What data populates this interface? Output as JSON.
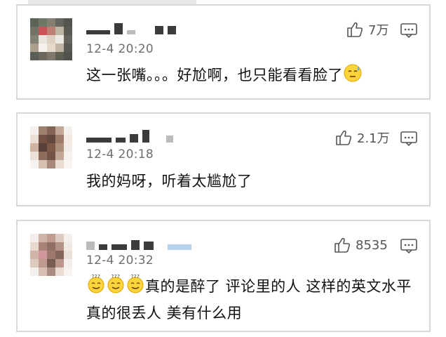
{
  "comments": [
    {
      "timestamp": "12-4 20:20",
      "text": "这一张嘴。。。好尬啊，也只能看看脸了",
      "likes": "7万",
      "avatar_colors": [
        "#3d4a3a",
        "#56604e",
        "#6f6a5a",
        "#4a4c42",
        "#34382f",
        "#5a5c4e",
        "#c3363a",
        "#b46a5e",
        "#b1aa93",
        "#3d3f36",
        "#6e6c5a",
        "#e6e0d6",
        "#d8cab8",
        "#e8e4dc",
        "#4a4a40",
        "#9b8f78",
        "#f4efe9",
        "#e3d4c1",
        "#b6a892",
        "#3a3c34",
        "#3d443a",
        "#544e43",
        "#6b6153",
        "#424236",
        "#33352f"
      ]
    },
    {
      "timestamp": "12-4 20:18",
      "text": "我的妈呀，听着太尴尬了",
      "likes": "2.1万",
      "avatar_colors": [
        "#f2eeea",
        "#8d6b54",
        "#6f4a38",
        "#b79a86",
        "#f3efeb",
        "#e6dad0",
        "#5a3323",
        "#4a2a1e",
        "#8c6652",
        "#efe6de",
        "#c8a690",
        "#3a2016",
        "#6b3d2b",
        "#9e7c66",
        "#f0e8e2",
        "#e8dcd2",
        "#7a5440",
        "#5b3626",
        "#b99a86",
        "#f4f0ec",
        "#f5f2ef",
        "#d0b6a2",
        "#9a7462",
        "#e6d8cc",
        "#f6f3f0"
      ]
    },
    {
      "timestamp": "12-4 20:32",
      "text": "真的是醉了 评论里的人 这样的英文水平真的很丢人  美有什么用",
      "likes": "8535",
      "avatar_colors": [
        "#f1ece8",
        "#c7a899",
        "#b68d7d",
        "#d8c3b7",
        "#f3eeea",
        "#e4d3c9",
        "#9b6f5f",
        "#7d564a",
        "#a57f70",
        "#efe6e0",
        "#c9a79a",
        "#c9868d",
        "#8e6154",
        "#6f4b41",
        "#e8dcd4",
        "#d9c3b6",
        "#b48a7c",
        "#5f4038",
        "#ad8777",
        "#f2ece8",
        "#f3eeeb",
        "#d1b3a5",
        "#9c776a",
        "#e7d6cc",
        "#f5f1ee"
      ]
    }
  ],
  "colors": {
    "border": "#d8d8d8",
    "timestamp": "#6e6e6e",
    "icon": "#555555"
  },
  "icons": {
    "like": "thumbs-up-icon",
    "reply": "comment-icon",
    "emoji_sweat": "sweat-emoji-icon",
    "emoji_sleepy": "dizzy-smile-emoji-icon"
  }
}
